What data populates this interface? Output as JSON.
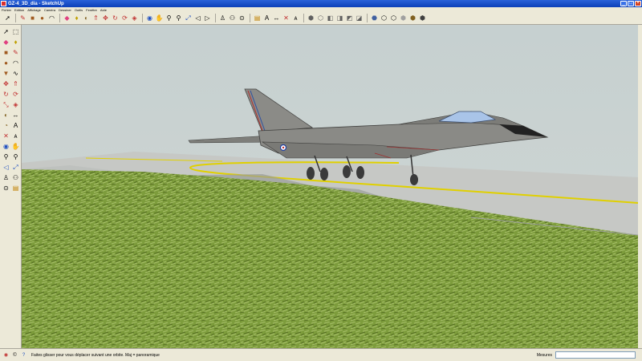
{
  "window": {
    "title": "GZ-4_3D_dia - SketchUp"
  },
  "menu": [
    "Fichier",
    "Edition",
    "Affichage",
    "Caméra",
    "Dessiner",
    "Outils",
    "Fenêtre",
    "Aide"
  ],
  "status": {
    "hint": "Faites glisser pour vous déplacer suivant une orbite.  Maj = panoramique",
    "measures_label": "Mesures",
    "measures_value": ""
  },
  "icons": {
    "toolbar": [
      "select-arrow-icon",
      "pencil-line-icon",
      "rectangle-icon",
      "circle-icon",
      "arc-icon",
      "eraser-icon",
      "paint-bucket-icon",
      "tape-measure-icon",
      "push-pull-icon",
      "move-icon",
      "rotate-icon",
      "follow-me-icon",
      "offset-icon",
      "orbit-icon",
      "pan-icon",
      "zoom-icon",
      "zoom-window-icon",
      "zoom-extents-icon",
      "previous-view-icon",
      "next-view-icon",
      "position-camera-icon",
      "walk-icon",
      "look-around-icon",
      "section-plane-icon",
      "text-icon",
      "dimension-icon",
      "axes-icon",
      "3d-text-icon",
      "iso-view-icon",
      "top-view-icon",
      "front-view-icon",
      "right-view-icon",
      "back-view-icon",
      "left-view-icon",
      "xray-icon",
      "wireframe-icon",
      "hidden-line-icon",
      "shaded-icon",
      "shaded-textures-icon",
      "monochrome-icon"
    ],
    "left_tools": [
      "select-arrow-icon",
      "make-component-icon",
      "eraser-icon",
      "paint-bucket-icon",
      "rectangle-icon",
      "pencil-line-icon",
      "circle-icon",
      "arc-icon",
      "polygon-icon",
      "freehand-icon",
      "move-icon",
      "push-pull-icon",
      "rotate-icon",
      "follow-me-icon",
      "scale-icon",
      "offset-icon",
      "tape-measure-icon",
      "dimension-icon",
      "protractor-icon",
      "text-icon",
      "axes-icon",
      "3d-text-icon",
      "orbit-icon",
      "pan-icon",
      "zoom-icon",
      "zoom-window-icon",
      "previous-view-icon",
      "zoom-extents-icon",
      "position-camera-icon",
      "walk-icon",
      "look-around-icon",
      "section-plane-icon"
    ]
  },
  "colors": {
    "sky": "#c8d2d2",
    "ground": "#7a9a3a",
    "tarmac": "#c5c7c4",
    "taxi_line": "#e0d000",
    "aircraft": "#8a8a86"
  }
}
